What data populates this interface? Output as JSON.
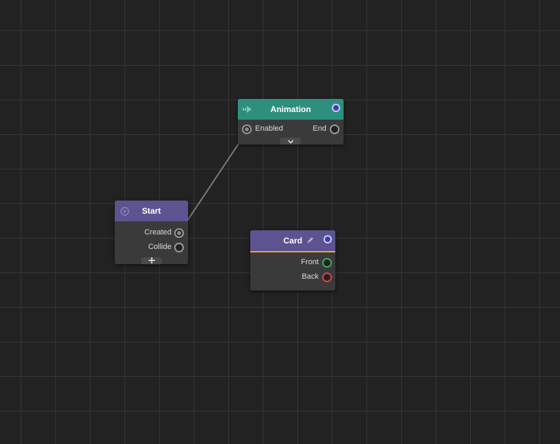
{
  "canvas": {
    "grid_color": "#363636",
    "background_color": "#222222"
  },
  "nodes": {
    "animation": {
      "title": "Animation",
      "header_color": "#2f8f7f",
      "icon": "arrow-right-icon",
      "output_port_color": "#3a3ad0",
      "inputs": [
        {
          "label": "Enabled"
        }
      ],
      "outputs": [
        {
          "label": "End"
        }
      ],
      "expand_icon": "chevron-down-icon"
    },
    "start": {
      "title": "Start",
      "header_color": "#5d5390",
      "icon": "play-circle-icon",
      "outputs": [
        {
          "label": "Created"
        },
        {
          "label": "Collide"
        }
      ],
      "add_icon": "plus-icon"
    },
    "card": {
      "title": "Card",
      "header_color": "#5d5390",
      "accent_color": "#e7a73b",
      "icon": "pencil-icon",
      "output_port_color": "#3a3ad0",
      "outputs": [
        {
          "label": "Front",
          "color": "#3fae5c"
        },
        {
          "label": "Back",
          "color": "#d84444"
        }
      ]
    }
  },
  "connections": [
    {
      "from": "Start.Created",
      "to": "Animation.Enabled"
    }
  ]
}
